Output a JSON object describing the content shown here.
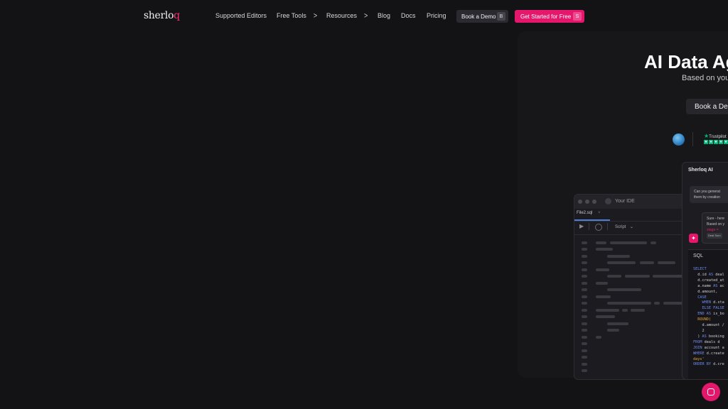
{
  "nav": {
    "logo_main": "sherlo",
    "logo_accent": "q",
    "links": [
      {
        "label": "Supported Editors"
      },
      {
        "label": "Free Tools",
        "chevron": ">"
      },
      {
        "label": "Resources",
        "chevron": ">"
      },
      {
        "label": "Blog"
      },
      {
        "label": "Docs"
      },
      {
        "label": "Pricing"
      }
    ],
    "book_demo": {
      "label": "Book a Demo",
      "shortcut": "B"
    },
    "get_started": {
      "label": "Get Started for Free",
      "shortcut": "S"
    }
  },
  "hero": {
    "title": "AI Data Ag",
    "subtitle": "Based on you",
    "cta": "Book a Der",
    "trustpilot": "Trustpilot",
    "trustpilot_stars": [
      "★",
      "★",
      "★",
      "★",
      "★"
    ]
  },
  "ide": {
    "title": "Your IDE",
    "tab": "File2.sql",
    "tab_close": "×",
    "play": "▶",
    "script_label": "Script",
    "script_chevron": "⌄"
  },
  "ai": {
    "title": "Sherloq AI",
    "question_l1": "Can you generat",
    "question_l2": "them by creation",
    "answer_l1": "Sure - here",
    "answer_l2": "Based on y",
    "answer_err": "stage =",
    "answer_chip": "Deal Sum",
    "sparkle": "✦",
    "sql_label": "SQL"
  },
  "sql_lines": [
    [
      {
        "t": "SELECT",
        "k": "kw"
      }
    ],
    [
      {
        "t": "  d.id "
      },
      {
        "t": "AS",
        "k": "kw"
      },
      {
        "t": " deal"
      }
    ],
    [
      {
        "t": "  d.created_at"
      }
    ],
    [
      {
        "t": "  a.name "
      },
      {
        "t": "AS",
        "k": "kw"
      },
      {
        "t": " ac"
      }
    ],
    [
      {
        "t": "  d.amount,"
      }
    ],
    [
      {
        "t": "  CASE",
        "k": "kw"
      }
    ],
    [
      {
        "t": "    WHEN",
        "k": "kw"
      },
      {
        "t": " d.sta"
      }
    ],
    [
      {
        "t": "    ELSE FALSE",
        "k": "kw"
      }
    ],
    [
      {
        "t": "  END AS",
        "k": "kw"
      },
      {
        "t": " is_bo"
      }
    ],
    [
      {
        "t": "  ROUND(",
        "k": "str"
      }
    ],
    [
      {
        "t": "    d.amount /"
      }
    ],
    [
      {
        "t": "    2"
      }
    ],
    [
      {
        "t": "  ) "
      },
      {
        "t": "AS",
        "k": "kw"
      },
      {
        "t": " booking"
      }
    ],
    [
      {
        "t": "FROM",
        "k": "kw"
      },
      {
        "t": " deals d"
      }
    ],
    [
      {
        "t": "JOIN",
        "k": "kw"
      },
      {
        "t": " account a"
      }
    ],
    [
      {
        "t": "WHERE",
        "k": "kw"
      },
      {
        "t": " d.create"
      }
    ],
    [
      {
        "t": "days'",
        "k": "str"
      }
    ],
    [
      {
        "t": "ORDER BY",
        "k": "kw"
      },
      {
        "t": " d.cre"
      }
    ]
  ],
  "colors": {
    "accent": "#e5176c",
    "background": "#131316"
  }
}
